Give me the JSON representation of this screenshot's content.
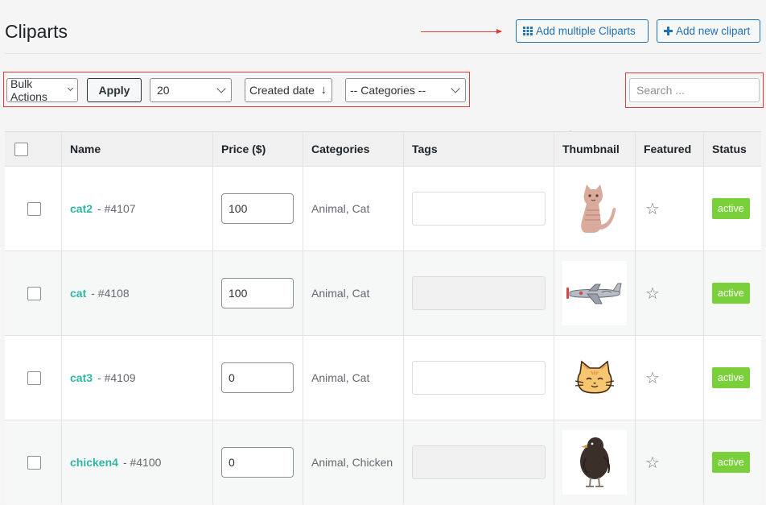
{
  "page": {
    "title": "Cliparts"
  },
  "header": {
    "add_multiple_label": "Add multiple Cliparts",
    "add_new_label": "Add new clipart",
    "grid_icon": "grid-icon",
    "plus_icon": "plus-icon"
  },
  "toolbar": {
    "bulk_actions": "Bulk Actions",
    "apply": "Apply",
    "per_page": "20",
    "sort": "Created date",
    "sort_icon": "arrow-down-icon",
    "categories": "-- Categories --",
    "search_placeholder": "Search ..."
  },
  "table": {
    "columns": [
      "Name",
      "Price ($)",
      "Categories",
      "Tags",
      "Thumbnail",
      "Featured",
      "Status"
    ],
    "rows": [
      {
        "name": "cat2",
        "id": "- #4107",
        "price": "100",
        "categories": "Animal, Cat",
        "thumbnail": "standing-cat",
        "status": "active"
      },
      {
        "name": "cat",
        "id": "- #4108",
        "price": "100",
        "categories": "Animal, Cat",
        "thumbnail": "airplane",
        "status": "active"
      },
      {
        "name": "cat3",
        "id": "- #4109",
        "price": "0",
        "categories": "Animal, Cat",
        "thumbnail": "cat-face",
        "status": "active"
      },
      {
        "name": "chicken4",
        "id": "- #4100",
        "price": "0",
        "categories": "Animal, Chicken",
        "thumbnail": "black-chicken",
        "status": "active"
      }
    ]
  },
  "colors": {
    "accent": "#2271b1",
    "link": "#30b5a5",
    "status_active": "#7ad03a",
    "annotation": "#e53935"
  }
}
